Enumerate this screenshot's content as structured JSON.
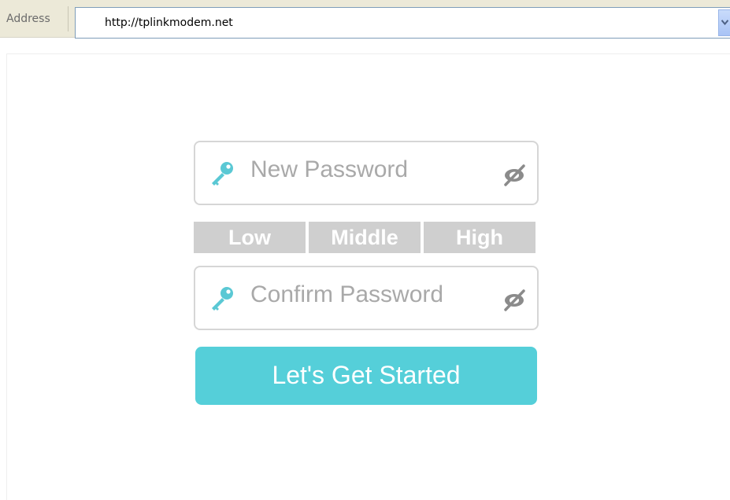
{
  "browser": {
    "address_label": "Address",
    "url": "http://tplinkmodem.net"
  },
  "form": {
    "new_password": {
      "placeholder": "New Password",
      "icon": "key-icon",
      "toggle_icon": "eye-off-icon"
    },
    "strength": {
      "levels": [
        "Low",
        "Middle",
        "High"
      ]
    },
    "confirm_password": {
      "placeholder": "Confirm Password",
      "icon": "key-icon",
      "toggle_icon": "eye-off-icon"
    },
    "submit_label": "Let's Get Started"
  },
  "colors": {
    "accent": "#55cfd9",
    "strength_bar": "#cfcfcf",
    "placeholder_text": "#a9a9a9",
    "field_border": "#d6d6d6"
  }
}
